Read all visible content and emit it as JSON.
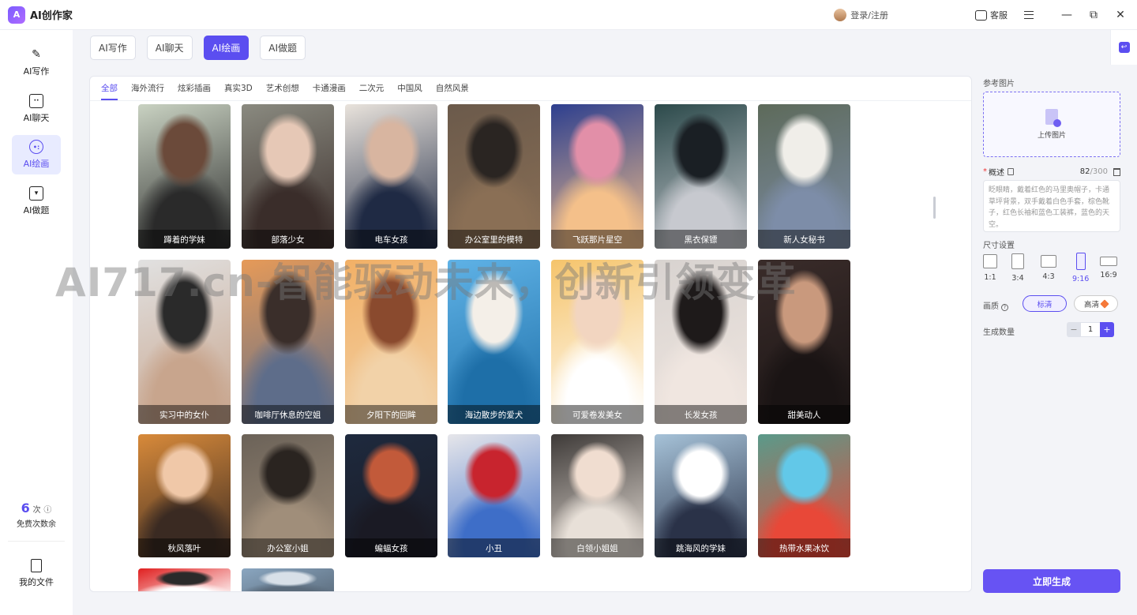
{
  "app": {
    "title": "AI创作家"
  },
  "titlebar": {
    "login_label": "登录/注册",
    "service_label": "客服"
  },
  "sidebar": {
    "items": [
      {
        "label": "AI写作",
        "icon": "pen-icon",
        "active": false
      },
      {
        "label": "AI聊天",
        "icon": "chat-icon",
        "active": false
      },
      {
        "label": "AI绘画",
        "icon": "palette-icon",
        "active": true
      },
      {
        "label": "AI做题",
        "icon": "book-icon",
        "active": false
      }
    ],
    "credits_number": "6",
    "credits_unit": "次",
    "credits_label": "免费次数余",
    "files_label": "我的文件"
  },
  "tabs": [
    {
      "label": "AI写作",
      "active": false
    },
    {
      "label": "AI聊天",
      "active": false
    },
    {
      "label": "AI绘画",
      "active": true
    },
    {
      "label": "AI做题",
      "active": false
    }
  ],
  "categories": [
    {
      "label": "全部",
      "active": true
    },
    {
      "label": "海外流行",
      "active": false
    },
    {
      "label": "炫彩插画",
      "active": false
    },
    {
      "label": "真实3D",
      "active": false
    },
    {
      "label": "艺术创想",
      "active": false
    },
    {
      "label": "卡通漫画",
      "active": false
    },
    {
      "label": "二次元",
      "active": false
    },
    {
      "label": "中国风",
      "active": false
    },
    {
      "label": "自然风景",
      "active": false
    }
  ],
  "gallery": [
    [
      {
        "caption": "蹲着的学妹",
        "colors": [
          "#c9d2c2",
          "#6b4a3a",
          "#2a2a2a"
        ]
      },
      {
        "caption": "部落少女",
        "colors": [
          "#8a8a80",
          "#e6c8b6",
          "#3a2d2a"
        ]
      },
      {
        "caption": "电车女孩",
        "colors": [
          "#e9e3dc",
          "#d8b5a0",
          "#1f2a44"
        ]
      },
      {
        "caption": "办公室里的模特",
        "colors": [
          "#6b5a4b",
          "#2a2522",
          "#8a6f55"
        ]
      },
      {
        "caption": "飞跃那片星空",
        "colors": [
          "#2d3f8f",
          "#e28fa8",
          "#f4c08a"
        ]
      },
      {
        "caption": "黑衣保镖",
        "colors": [
          "#2c4a4b",
          "#1a1f24",
          "#c7c9cf"
        ]
      },
      {
        "caption": "新人女秘书",
        "colors": [
          "#5d6a5a",
          "#f0eee9",
          "#7d8da8"
        ]
      }
    ],
    [
      {
        "caption": "实习中的女仆",
        "colors": [
          "#e1e1e1",
          "#2a2a2a",
          "#c8a58d"
        ]
      },
      {
        "caption": "咖啡厅休息的空姐",
        "colors": [
          "#e69a58",
          "#3a2e2a",
          "#5e6d8a"
        ]
      },
      {
        "caption": "夕阳下的回眸",
        "colors": [
          "#f2b066",
          "#8a4a2e",
          "#f2d2a8"
        ]
      },
      {
        "caption": "海边散步的爱犬",
        "colors": [
          "#5fb2e6",
          "#f4efe8",
          "#1e6fa8"
        ]
      },
      {
        "caption": "可爱卷发美女",
        "colors": [
          "#f5c46b",
          "#f2d5c0",
          "#ffffff"
        ]
      },
      {
        "caption": "长发女孩",
        "colors": [
          "#d8d3d0",
          "#1e1a1a",
          "#f0e6e0"
        ]
      },
      {
        "caption": "甜美动人",
        "colors": [
          "#3a2c2a",
          "#c9997d",
          "#1a1414"
        ]
      }
    ],
    [
      {
        "caption": "秋风落叶",
        "colors": [
          "#d88a3a",
          "#f0c8a8",
          "#3a2a22"
        ]
      },
      {
        "caption": "办公室小姐",
        "colors": [
          "#6b6258",
          "#2a2420",
          "#a08e7a"
        ]
      },
      {
        "caption": "蝙蝠女孩",
        "colors": [
          "#1e2a3e",
          "#c25a3a",
          "#1a1a24"
        ]
      },
      {
        "caption": "小丑",
        "colors": [
          "#e6e6ea",
          "#c8242e",
          "#3e6ec8"
        ]
      },
      {
        "caption": "白领小姐姐",
        "colors": [
          "#3e3a38",
          "#f0ddd0",
          "#e8e0d8"
        ]
      },
      {
        "caption": "跳海风的学妹",
        "colors": [
          "#a6c2d8",
          "#ffffff",
          "#2a3248"
        ]
      },
      {
        "caption": "热带水果冰饮",
        "colors": [
          "#5a9a8a",
          "#62c8e8",
          "#e84838"
        ]
      }
    ],
    [
      {
        "caption": "",
        "colors": [
          "#e02020",
          "#2a2a2a",
          "#ffffff"
        ]
      },
      {
        "caption": "",
        "colors": [
          "#8aa6c0",
          "#d8e0e8",
          "#5a6a7a"
        ]
      }
    ]
  ],
  "watermark": "AI717.cn-智能驱动未来，创新引领变革",
  "right_panel": {
    "ref_label": "参考图片",
    "upload_label": "上传图片",
    "desc_label": "概述",
    "desc_count": "82",
    "desc_max": "/300",
    "desc_text": "眨眼睛，戴着红色的马里奥帽子，卡通草坪背景，双手戴着白色手套，棕色靴子，红色长袖和蓝色工装裤，蓝色的天空。",
    "size_label": "尺寸设置",
    "ratios": [
      {
        "label": "1:1",
        "active": false
      },
      {
        "label": "3:4",
        "active": false
      },
      {
        "label": "4:3",
        "active": false
      },
      {
        "label": "9:16",
        "active": true
      },
      {
        "label": "16:9",
        "active": false
      }
    ],
    "quality_label": "画质",
    "quality_options": [
      {
        "label": "标清",
        "active": true
      },
      {
        "label": "高清",
        "active": false
      }
    ],
    "count_label": "生成数量",
    "count_value": "1",
    "generate_label": "立即生成"
  },
  "colors": {
    "accent": "#5b4ef0",
    "background": "#f3f4f8"
  }
}
